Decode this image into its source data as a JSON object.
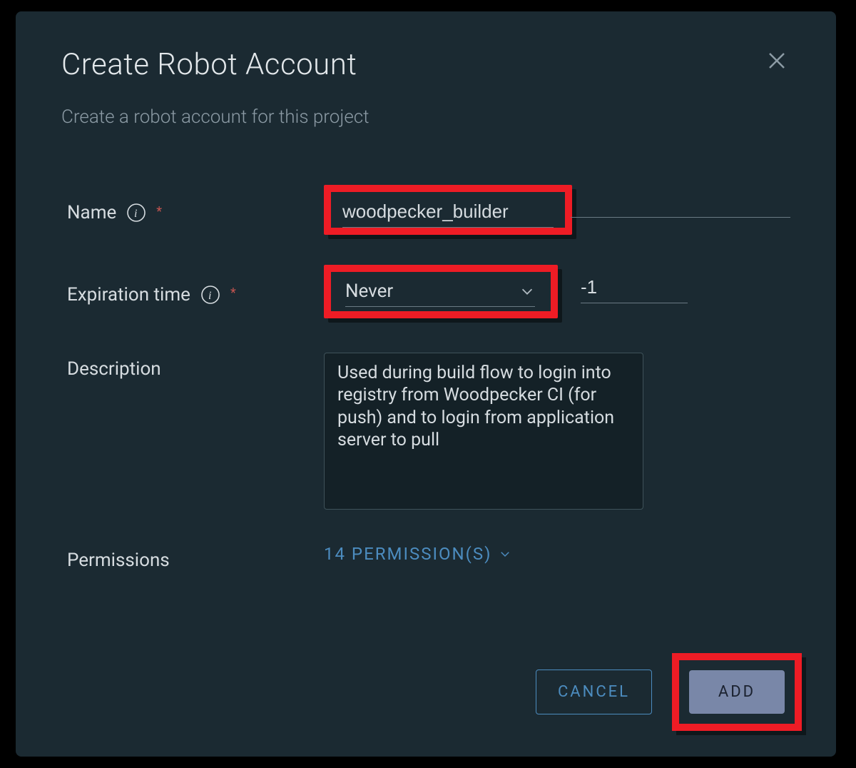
{
  "modal": {
    "title": "Create Robot Account",
    "subtitle": "Create a robot account for this project"
  },
  "form": {
    "name": {
      "label": "Name",
      "value": "woodpecker_builder"
    },
    "expiration": {
      "label": "Expiration time",
      "select_value": "Never",
      "days_value": "-1"
    },
    "description": {
      "label": "Description",
      "value": "Used during build flow to login into registry from Woodpecker CI (for push) and to login from application server to pull"
    },
    "permissions": {
      "label": "Permissions",
      "link_text": "14 PERMISSION(S)"
    }
  },
  "footer": {
    "cancel": "CANCEL",
    "add": "ADD"
  },
  "highlight_color": "#EE1C25"
}
